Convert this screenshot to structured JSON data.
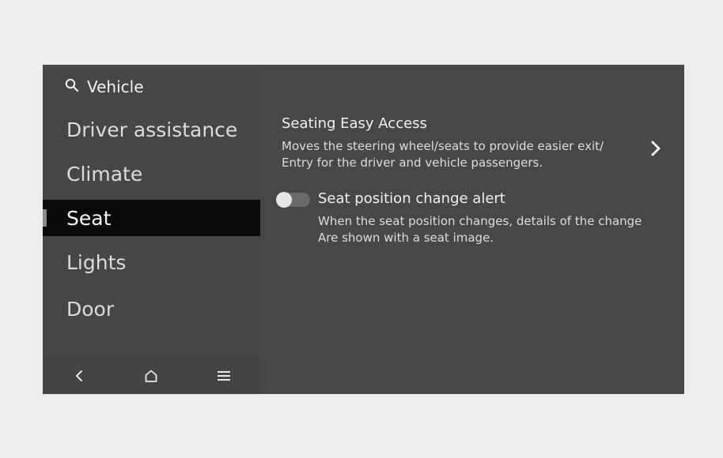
{
  "search": {
    "icon": "search-icon",
    "label": "Vehicle"
  },
  "sidebar": {
    "items": [
      {
        "label": "Driver assistance",
        "selected": false
      },
      {
        "label": "Climate",
        "selected": false
      },
      {
        "label": "Seat",
        "selected": true
      },
      {
        "label": "Lights",
        "selected": false
      },
      {
        "label": "Door",
        "selected": false
      }
    ]
  },
  "navbar": {
    "icons": [
      "back-icon",
      "home-icon",
      "menu-icon"
    ]
  },
  "settings": {
    "easy_access": {
      "title": "Seating Easy Access",
      "desc_line1": "Moves the steering wheel/seats to provide easier exit/",
      "desc_line2": "Entry for the driver and vehicle passengers.",
      "icon": "chevron-right-icon"
    },
    "seat_alert": {
      "title": "Seat position change alert",
      "desc_line1": "When the seat position changes, details of the change",
      "desc_line2": "Are shown with a seat image.",
      "enabled": false
    }
  },
  "colors": {
    "screen_bg": "#474747",
    "selected_bg": "#0a0a0a",
    "page_bg": "#ededec"
  }
}
